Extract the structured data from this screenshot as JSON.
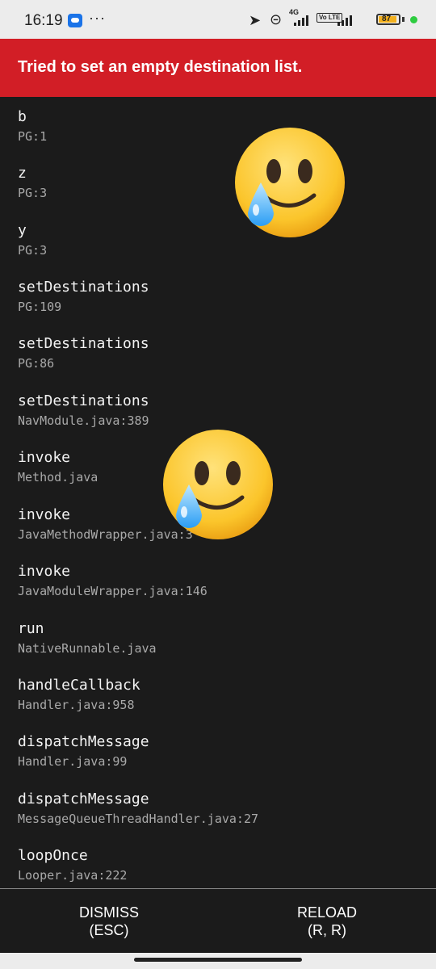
{
  "status_bar": {
    "time": "16:19",
    "more": "···",
    "network": "4G",
    "volte": "Vo LTE",
    "battery": "87"
  },
  "error": {
    "title": "Tried to set an empty destination list."
  },
  "stack": [
    {
      "method": "b",
      "location": "PG:1"
    },
    {
      "method": "z",
      "location": "PG:3"
    },
    {
      "method": "y",
      "location": "PG:3"
    },
    {
      "method": "setDestinations",
      "location": "PG:109"
    },
    {
      "method": "setDestinations",
      "location": "PG:86"
    },
    {
      "method": "setDestinations",
      "location": "NavModule.java:389"
    },
    {
      "method": "invoke",
      "location": "Method.java"
    },
    {
      "method": "invoke",
      "location": "JavaMethodWrapper.java:3"
    },
    {
      "method": "invoke",
      "location": "JavaModuleWrapper.java:146"
    },
    {
      "method": "run",
      "location": "NativeRunnable.java"
    },
    {
      "method": "handleCallback",
      "location": "Handler.java:958"
    },
    {
      "method": "dispatchMessage",
      "location": "Handler.java:99"
    },
    {
      "method": "dispatchMessage",
      "location": "MessageQueueThreadHandler.java:27"
    },
    {
      "method": "loopOnce",
      "location": "Looper.java:222"
    }
  ],
  "footer": {
    "dismiss_label": "DISMISS",
    "dismiss_key": "(ESC)",
    "reload_label": "RELOAD",
    "reload_key": "(R, R)"
  },
  "stickers": [
    "smiling-face-with-tear-icon",
    "smiling-face-with-tear-icon"
  ]
}
